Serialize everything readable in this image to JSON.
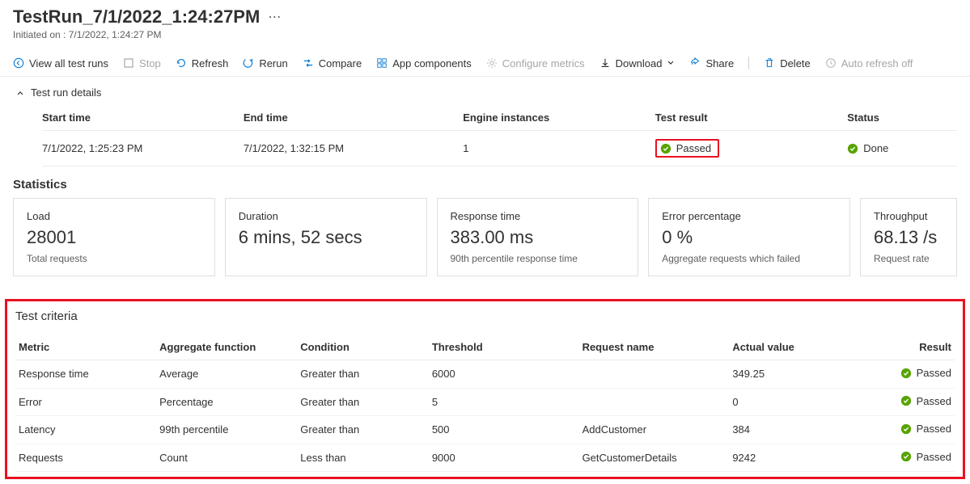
{
  "header": {
    "title": "TestRun_7/1/2022_1:24:27PM",
    "subtitle": "Initiated on : 7/1/2022, 1:24:27 PM"
  },
  "toolbar": {
    "view_all": "View all test runs",
    "stop": "Stop",
    "refresh": "Refresh",
    "rerun": "Rerun",
    "compare": "Compare",
    "app_components": "App components",
    "configure_metrics": "Configure metrics",
    "download": "Download",
    "share": "Share",
    "delete": "Delete",
    "auto_refresh": "Auto refresh off"
  },
  "details": {
    "section_label": "Test run details",
    "headers": {
      "start": "Start time",
      "end": "End time",
      "engine": "Engine instances",
      "result": "Test result",
      "status": "Status"
    },
    "row": {
      "start": "7/1/2022, 1:25:23 PM",
      "end": "7/1/2022, 1:32:15 PM",
      "engine": "1",
      "result": "Passed",
      "status": "Done"
    }
  },
  "stats": {
    "title": "Statistics",
    "cards": [
      {
        "label": "Load",
        "value": "28001",
        "sub": "Total requests"
      },
      {
        "label": "Duration",
        "value": "6 mins, 52 secs",
        "sub": ""
      },
      {
        "label": "Response time",
        "value": "383.00 ms",
        "sub": "90th percentile response time"
      },
      {
        "label": "Error percentage",
        "value": "0 %",
        "sub": "Aggregate requests which failed"
      },
      {
        "label": "Throughput",
        "value": "68.13 /s",
        "sub": "Request rate"
      }
    ]
  },
  "criteria": {
    "title": "Test criteria",
    "headers": {
      "metric": "Metric",
      "agg": "Aggregate function",
      "cond": "Condition",
      "thresh": "Threshold",
      "req": "Request name",
      "actual": "Actual value",
      "result": "Result"
    },
    "rows": [
      {
        "metric": "Response time",
        "agg": "Average",
        "cond": "Greater than",
        "thresh": "6000",
        "req": "",
        "actual": "349.25",
        "result": "Passed"
      },
      {
        "metric": "Error",
        "agg": "Percentage",
        "cond": "Greater than",
        "thresh": "5",
        "req": "",
        "actual": "0",
        "result": "Passed"
      },
      {
        "metric": "Latency",
        "agg": "99th percentile",
        "cond": "Greater than",
        "thresh": "500",
        "req": "AddCustomer",
        "actual": "384",
        "result": "Passed"
      },
      {
        "metric": "Requests",
        "agg": "Count",
        "cond": "Less than",
        "thresh": "9000",
        "req": "GetCustomerDetails",
        "actual": "9242",
        "result": "Passed"
      }
    ]
  }
}
